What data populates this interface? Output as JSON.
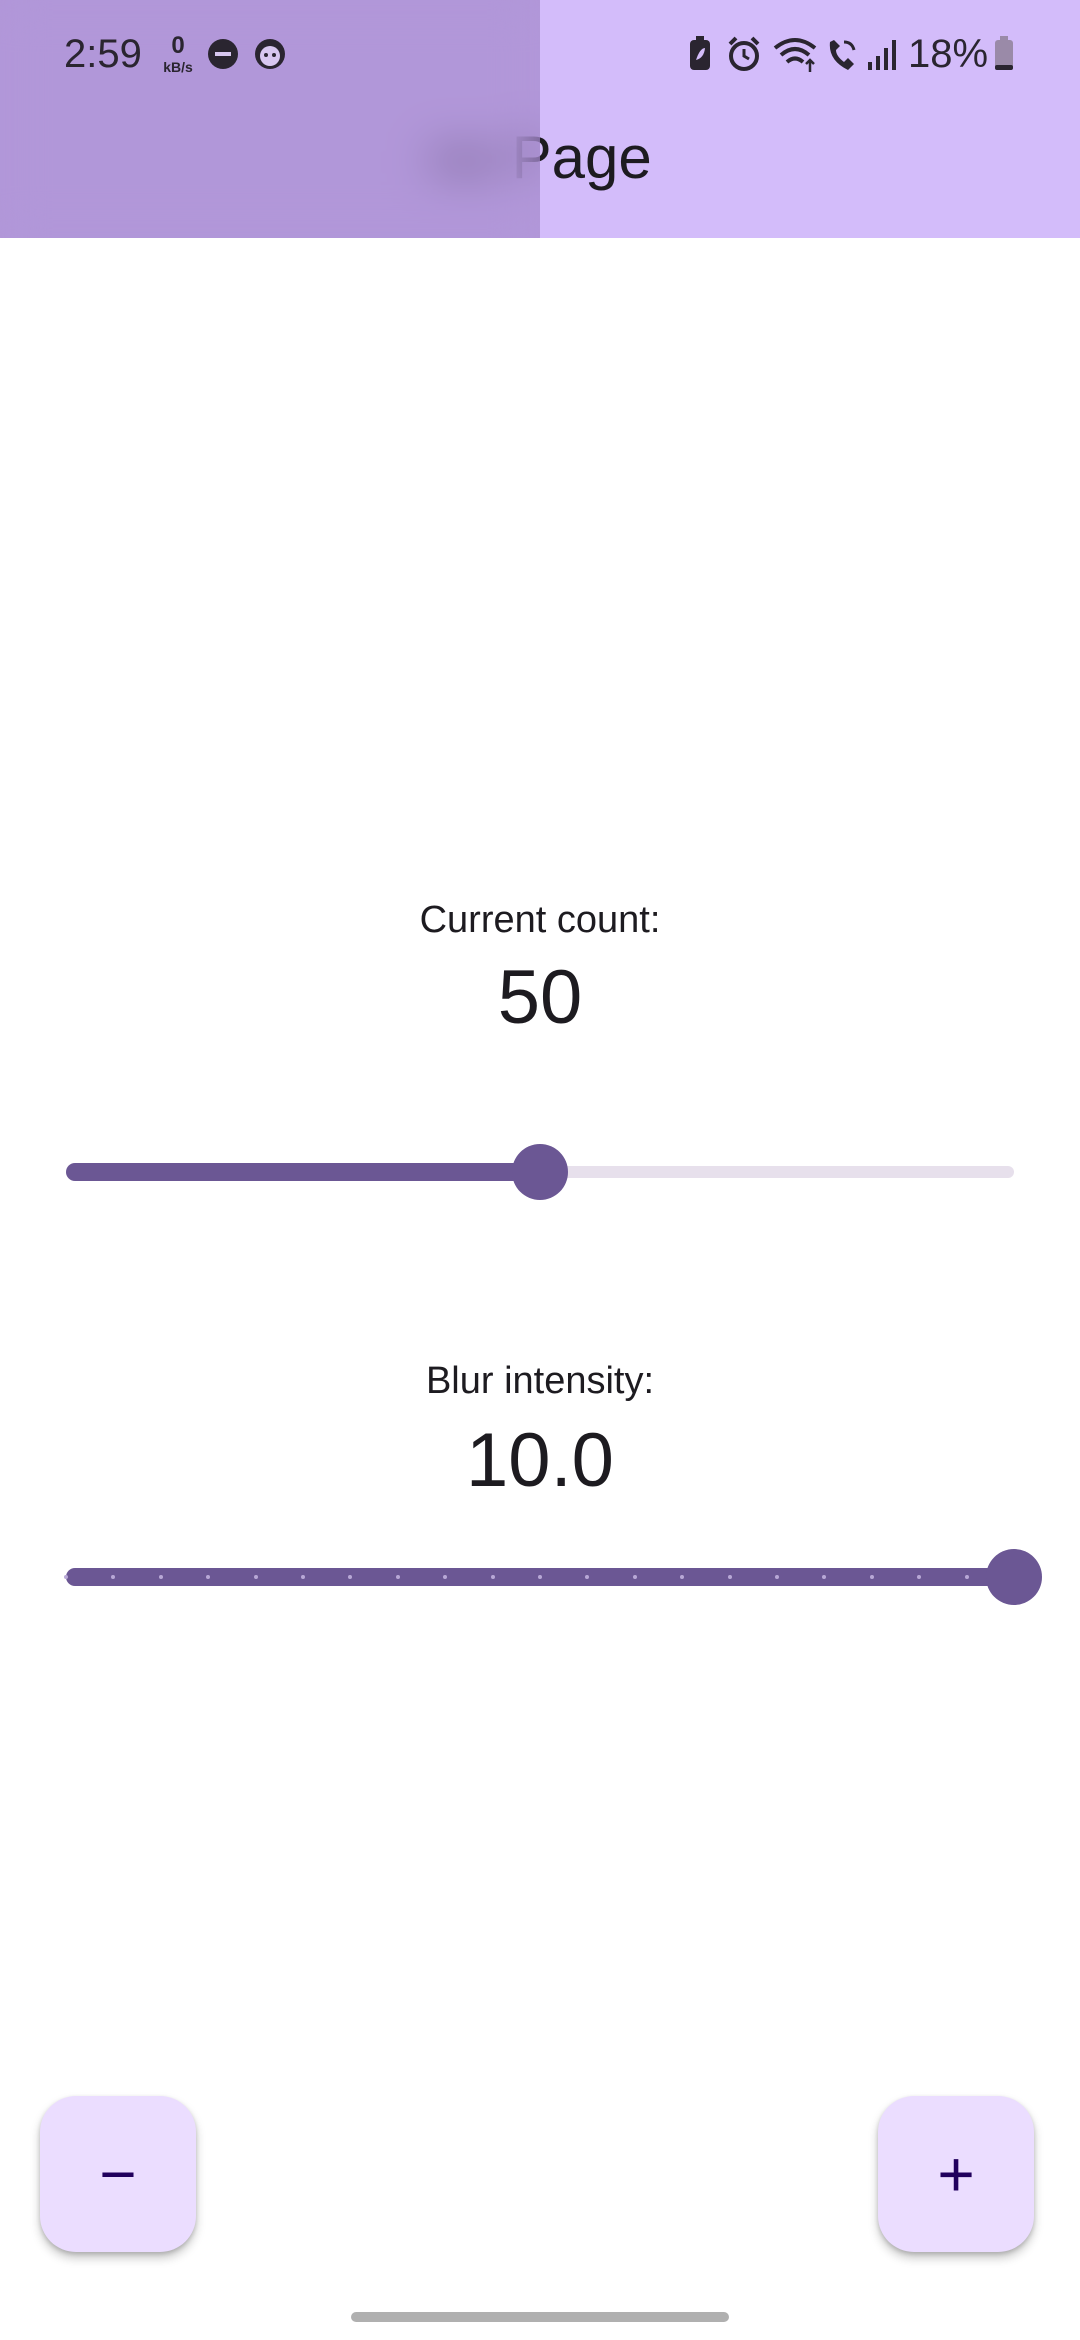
{
  "status_bar": {
    "time": "2:59",
    "network_speed_value": "0",
    "network_speed_unit": "kB/s",
    "battery_percent": "18%",
    "icons": [
      "do-not-disturb-icon",
      "face-icon",
      "battery-saver-icon",
      "alarm-icon",
      "wifi-icon",
      "wifi-calling-icon",
      "signal-icon",
      "battery-icon"
    ]
  },
  "app_bar": {
    "title": "ne Page"
  },
  "counter": {
    "label": "Current count:",
    "value": "50",
    "slider_fraction": 0.5
  },
  "blur": {
    "label": "Blur intensity:",
    "value": "10.0",
    "slider_fraction": 1.0,
    "divisions": 20
  },
  "fab": {
    "decrement_glyph": "−",
    "increment_glyph": "+"
  },
  "colors": {
    "primary": "#6b5794",
    "app_bar": "#d3bcfa",
    "fab": "#ebddff",
    "inactive_track": "#e7e0ec"
  }
}
